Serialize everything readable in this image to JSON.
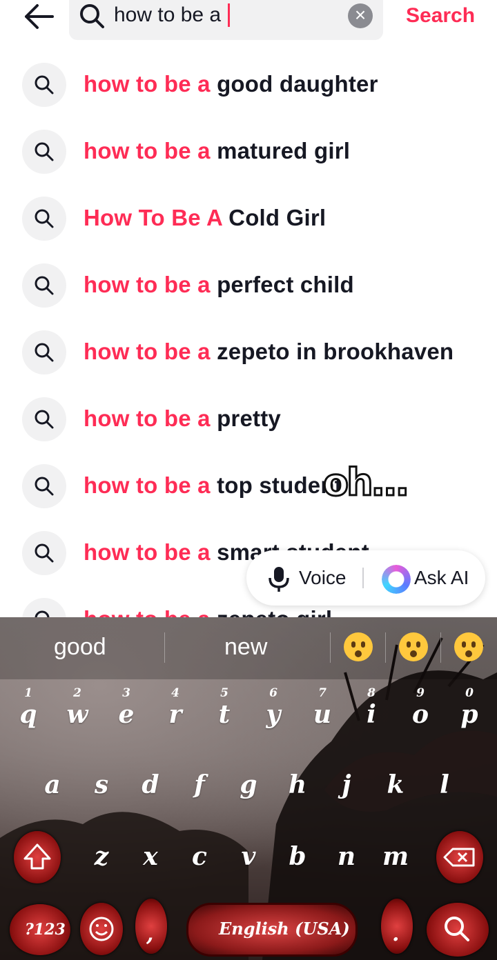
{
  "header": {
    "query": "how to be a ",
    "search_label": "Search"
  },
  "suggestions": [
    {
      "highlight": "how to be a",
      "rest": " good daughter"
    },
    {
      "highlight": "how to be a",
      "rest": " matured girl"
    },
    {
      "highlight": "How To Be A",
      "rest": " Cold Girl"
    },
    {
      "highlight": "how to be a",
      "rest": " perfect child"
    },
    {
      "highlight": "how to be a",
      "rest": " zepeto in brookhaven"
    },
    {
      "highlight": "how to be a",
      "rest": " pretty"
    },
    {
      "highlight": "how to be a",
      "rest": " top student"
    },
    {
      "highlight": "how to be a",
      "rest": " smart student"
    },
    {
      "highlight": "how to be a",
      "rest": " zepeto girl"
    }
  ],
  "sticker_text": "oh...",
  "pill": {
    "voice_label": "Voice",
    "ask_ai_label": "Ask AI"
  },
  "keyboard": {
    "suggestions": [
      "good",
      "new"
    ],
    "emojis": [
      "astonished-face-icon",
      "hushed-face-icon",
      "flushed-face-icon"
    ],
    "row1": [
      "q",
      "w",
      "e",
      "r",
      "t",
      "y",
      "u",
      "i",
      "o",
      "p"
    ],
    "row1_numbers": [
      "1",
      "2",
      "3",
      "4",
      "5",
      "6",
      "7",
      "8",
      "9",
      "0"
    ],
    "row2": [
      "a",
      "s",
      "d",
      "f",
      "g",
      "h",
      "j",
      "k",
      "l"
    ],
    "row3": [
      "z",
      "x",
      "c",
      "v",
      "b",
      "n",
      "m"
    ],
    "symbols_label": "?123",
    "space_label": "English (USA)",
    "comma": ",",
    "period": "."
  },
  "colors": {
    "accent": "#fe2c55",
    "text": "#161823",
    "chip": "#f1f1f2"
  }
}
